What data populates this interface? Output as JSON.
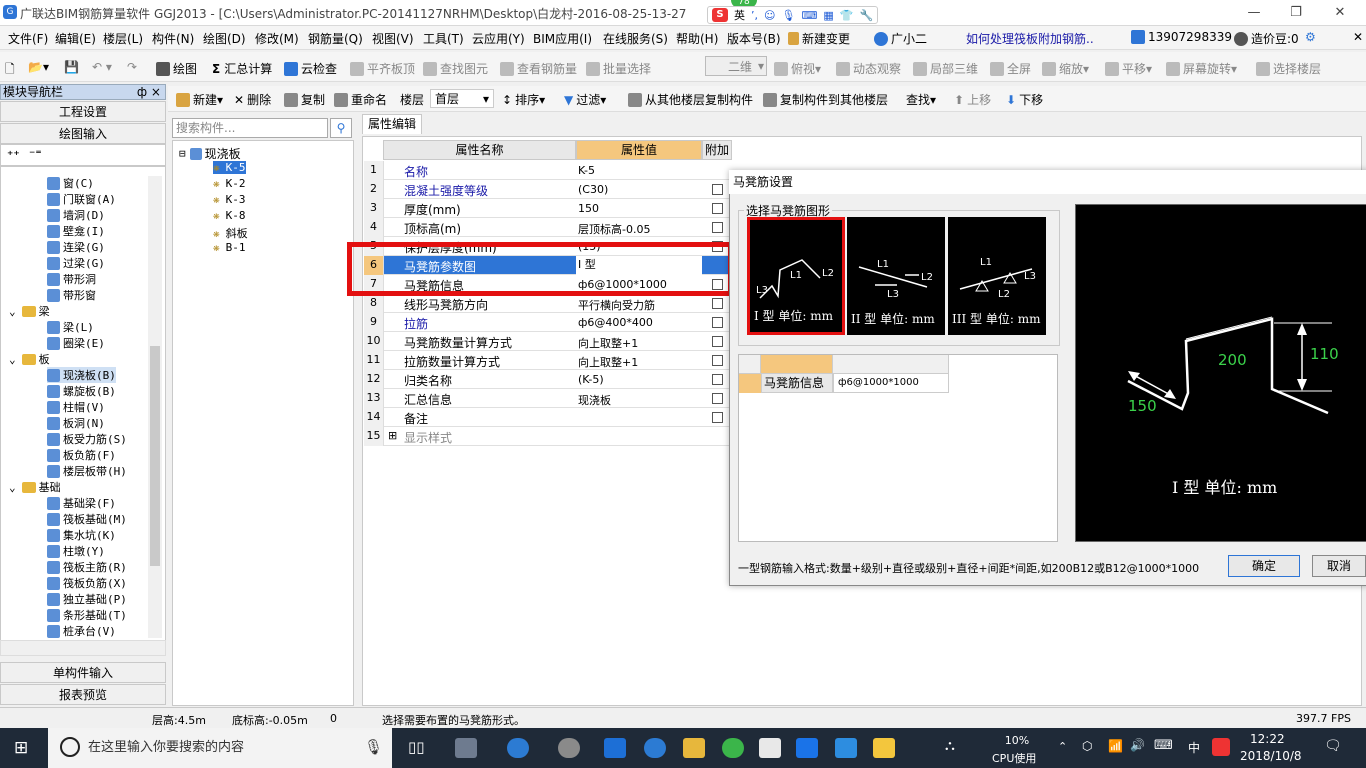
{
  "title": {
    "text": "广联达BIM钢筋算量软件 GGJ2013 - [C:\\Users\\Administrator.PC-20141127NRHM\\Desktop\\白龙村-2016-08-25-13-27",
    "badge": "78"
  },
  "ime": {
    "mode": "英"
  },
  "menu": [
    "文件(F)",
    "编辑(E)",
    "楼层(L)",
    "构件(N)",
    "绘图(D)",
    "修改(M)",
    "钢筋量(Q)",
    "视图(V)",
    "工具(T)",
    "云应用(Y)",
    "BIM应用(I)",
    "在线服务(S)",
    "帮助(H)",
    "版本号(B)",
    "新建变更",
    "广小二",
    "如何处理筏板附加钢筋..",
    "13907298339",
    "造价豆:0"
  ],
  "toolbar1": [
    "绘图",
    "汇总计算",
    "云检查",
    "平齐板顶",
    "查找图元",
    "查看钢筋量",
    "批量选择",
    "二维",
    "俯视",
    "动态观察",
    "局部三维",
    "全屏",
    "缩放",
    "平移",
    "屏幕旋转",
    "选择楼层"
  ],
  "toolbar2": [
    "新建",
    "删除",
    "复制",
    "重命名",
    "楼层",
    "首层",
    "排序",
    "过滤",
    "从其他楼层复制构件",
    "复制构件到其他楼层",
    "查找",
    "上移",
    "下移"
  ],
  "nav": {
    "header": "模块导航栏",
    "pin": "ф ×",
    "btn_project": "工程设置",
    "btn_draw": "绘图输入",
    "btn_single": "单构件输入",
    "btn_report": "报表预览",
    "items": [
      {
        "t": "窗(C)",
        "lvl": 2
      },
      {
        "t": "门联窗(A)",
        "lvl": 2
      },
      {
        "t": "墙洞(D)",
        "lvl": 2
      },
      {
        "t": "壁龛(I)",
        "lvl": 2
      },
      {
        "t": "连梁(G)",
        "lvl": 2
      },
      {
        "t": "过梁(G)",
        "lvl": 2
      },
      {
        "t": "带形洞",
        "lvl": 2
      },
      {
        "t": "带形窗",
        "lvl": 2
      },
      {
        "t": "梁",
        "lvl": 1
      },
      {
        "t": "梁(L)",
        "lvl": 2
      },
      {
        "t": "圈梁(E)",
        "lvl": 2
      },
      {
        "t": "板",
        "lvl": 1
      },
      {
        "t": "现浇板(B)",
        "lvl": 2
      },
      {
        "t": "螺旋板(B)",
        "lvl": 2
      },
      {
        "t": "柱帽(V)",
        "lvl": 2
      },
      {
        "t": "板洞(N)",
        "lvl": 2
      },
      {
        "t": "板受力筋(S)",
        "lvl": 2
      },
      {
        "t": "板负筋(F)",
        "lvl": 2
      },
      {
        "t": "楼层板带(H)",
        "lvl": 2
      },
      {
        "t": "基础",
        "lvl": 1
      },
      {
        "t": "基础梁(F)",
        "lvl": 2
      },
      {
        "t": "筏板基础(M)",
        "lvl": 2
      },
      {
        "t": "集水坑(K)",
        "lvl": 2
      },
      {
        "t": "柱墩(Y)",
        "lvl": 2
      },
      {
        "t": "筏板主筋(R)",
        "lvl": 2
      },
      {
        "t": "筏板负筋(X)",
        "lvl": 2
      },
      {
        "t": "独立基础(P)",
        "lvl": 2
      },
      {
        "t": "条形基础(T)",
        "lvl": 2
      },
      {
        "t": "桩承台(V)",
        "lvl": 2
      }
    ]
  },
  "search": {
    "placeholder": "搜索构件..."
  },
  "tree": {
    "root": "现浇板",
    "items": [
      "K-5",
      "K-2",
      "K-3",
      "K-8",
      "斜板",
      "B-1"
    ]
  },
  "props": {
    "tab": "属性编辑",
    "col_name": "属性名称",
    "col_value": "属性值",
    "col_extra": "附加",
    "rows": [
      {
        "n": "1",
        "k": "名称",
        "v": "K-5",
        "blue": true,
        "cb": false
      },
      {
        "n": "2",
        "k": "混凝土强度等级",
        "v": "(C30)",
        "blue": true,
        "cb": true
      },
      {
        "n": "3",
        "k": "厚度(mm)",
        "v": "150",
        "blue": false,
        "cb": true
      },
      {
        "n": "4",
        "k": "顶标高(m)",
        "v": "层顶标高-0.05",
        "blue": false,
        "cb": true
      },
      {
        "n": "5",
        "k": "保护层厚度(mm)",
        "v": "(15)",
        "blue": false,
        "cb": true
      },
      {
        "n": "6",
        "k": "马凳筋参数图",
        "v": "I 型",
        "blue": false,
        "cb": false
      },
      {
        "n": "7",
        "k": "马凳筋信息",
        "v": "ф6@1000*1000",
        "blue": false,
        "cb": true
      },
      {
        "n": "8",
        "k": "线形马凳筋方向",
        "v": "平行横向受力筋",
        "blue": false,
        "cb": true
      },
      {
        "n": "9",
        "k": "拉筋",
        "v": "ф6@400*400",
        "blue": true,
        "cb": true
      },
      {
        "n": "10",
        "k": "马凳筋数量计算方式",
        "v": "向上取整+1",
        "blue": false,
        "cb": true
      },
      {
        "n": "11",
        "k": "拉筋数量计算方式",
        "v": "向上取整+1",
        "blue": false,
        "cb": true
      },
      {
        "n": "12",
        "k": "归类名称",
        "v": "(K-5)",
        "blue": false,
        "cb": true
      },
      {
        "n": "13",
        "k": "汇总信息",
        "v": "现浇板",
        "blue": false,
        "cb": true
      },
      {
        "n": "14",
        "k": "备注",
        "v": "",
        "blue": false,
        "cb": true
      },
      {
        "n": "15",
        "k": "显示样式",
        "v": "",
        "blue": false,
        "cb": false
      }
    ]
  },
  "dialog": {
    "title": "马凳筋设置",
    "group": "选择马凳筋图形",
    "shapes": [
      {
        "label": "I 型 单位: mm"
      },
      {
        "label": "II 型 单位: mm"
      },
      {
        "label": "III 型 单位: mm"
      }
    ],
    "grid_key": "马凳筋信息",
    "grid_val": "ф6@1000*1000",
    "preview": {
      "d1": "200",
      "d2": "110",
      "d3": "150",
      "label": "I 型 单位: mm"
    },
    "hint": "一型钢筋输入格式:数量+级别+直径或级别+直径+间距*间距,如200B12或B12@1000*1000",
    "ok": "确定",
    "cancel": "取消",
    "shape_marks": {
      "s1": [
        "L1",
        "L2",
        "L3"
      ],
      "s2": [
        "L1",
        "L2",
        "L3"
      ],
      "s3": [
        "L1",
        "L3",
        "L2"
      ]
    }
  },
  "status": {
    "floor_h": "层高:4.5m",
    "bottom": "底标高:-0.05m",
    "zero": "0",
    "msg": "选择需要布置的马凳筋形式。",
    "fps": "397.7 FPS"
  },
  "taskbar": {
    "search": "在这里输入你要搜索的内容",
    "cpu_pct": "10%",
    "cpu_label": "CPU使用",
    "lang": "中",
    "time": "12:22",
    "date": "2018/10/8"
  }
}
